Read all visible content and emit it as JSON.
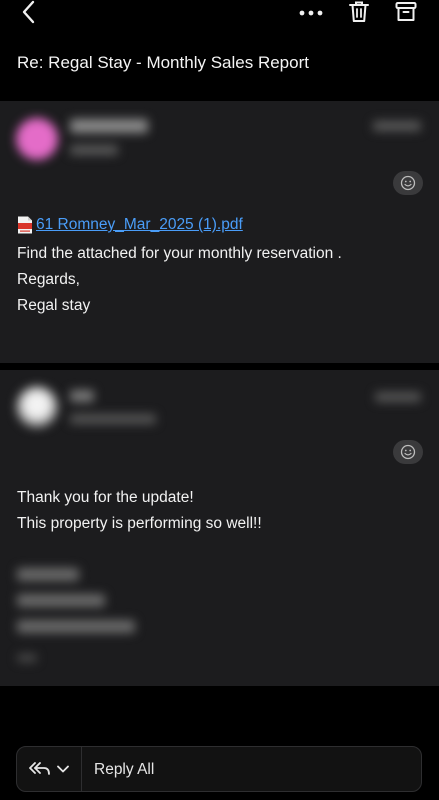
{
  "header": {
    "back_icon": "chevron-left-icon",
    "more_icon": "more-horizontal-icon",
    "trash_icon": "trash-icon",
    "archive_icon": "archive-icon"
  },
  "subject": "Re: Regal Stay - Monthly Sales Report",
  "messages": [
    {
      "attachment_name": "61 Romney_Mar_2025 (1).pdf",
      "body_lines": [
        "Find the attached for your monthly reservation .",
        "Regards,",
        "Regal stay"
      ]
    },
    {
      "body_lines": [
        "Thank you for the update!",
        "This property is performing so well!!"
      ]
    }
  ],
  "reply_bar": {
    "reply_icon": "reply-all-icon",
    "chevron_icon": "chevron-down-icon",
    "label": "Reply All"
  },
  "colors": {
    "link": "#4a9df8",
    "card_background": "#1c1c1e",
    "avatar1": "#e46cc8"
  }
}
